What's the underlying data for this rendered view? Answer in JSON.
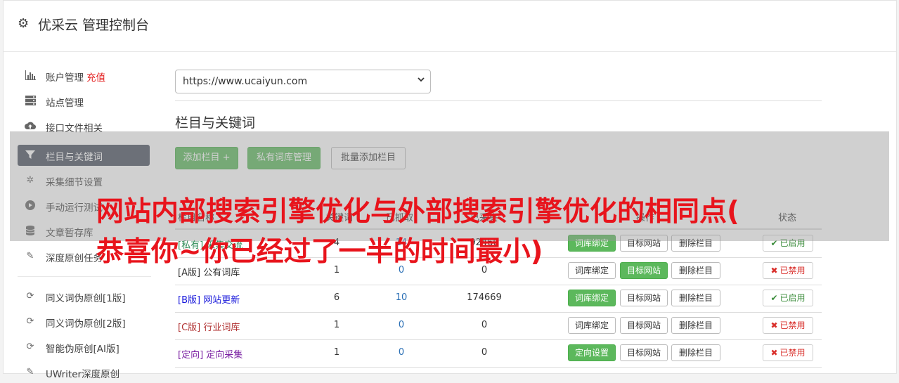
{
  "header": {
    "title": "优采云 管理控制台",
    "icon": "gear-icon"
  },
  "sidebar": {
    "items": [
      {
        "label": "账户管理",
        "badge": "充值",
        "icon": "bar-chart-icon"
      },
      {
        "label": "站点管理",
        "icon": "server-icon"
      },
      {
        "label": "接口文件相关",
        "icon": "cloud-upload-icon"
      },
      {
        "label": "栏目与关键词",
        "icon": "filter-icon"
      },
      {
        "label": "采集细节设置",
        "icon": "cogs-icon"
      },
      {
        "label": "手动运行测试",
        "icon": "play-circle-icon"
      },
      {
        "label": "文章暂存库",
        "icon": "database-icon"
      },
      {
        "label": "深度原创任务",
        "icon": "edit-icon"
      },
      {
        "label": "同义词伪原创[1版]",
        "icon": "refresh-icon"
      },
      {
        "label": "同义词伪原创[2版]",
        "icon": "refresh-icon"
      },
      {
        "label": "智能伪原创[AI版]",
        "icon": "refresh-icon"
      },
      {
        "label": "UWriter深度原创",
        "icon": "edit-icon"
      }
    ]
  },
  "main": {
    "site_select": {
      "value": "https://www.ucaiyun.com"
    },
    "section_title": "栏目与关键词",
    "buttons": {
      "add_column": "添加栏目 +",
      "private_lib": "私有词库管理",
      "batch_add": "批量添加栏目"
    },
    "table": {
      "headers": {
        "name": "栏目名称",
        "col2": "关键词",
        "col3": "已抓取",
        "col4": "已采集",
        "ops": "操作",
        "status": "状态"
      },
      "rows": [
        {
          "tag": "[私有]",
          "name": "采集交流",
          "a": "4",
          "b": "14",
          "c": "92460",
          "op1": "词库绑定",
          "op1_green": true,
          "op2": "目标网站",
          "op2_green": false,
          "op3": "删除栏目",
          "status": "已启用",
          "enabled": true
        },
        {
          "tag": "[A版]",
          "name": "公有词库",
          "a": "1",
          "b": "0",
          "c": "0",
          "op1": "词库绑定",
          "op1_green": false,
          "op2": "目标网站",
          "op2_green": true,
          "op3": "删除栏目",
          "status": "已禁用",
          "enabled": false
        },
        {
          "tag": "[B版]",
          "name": "网站更新",
          "a": "6",
          "b": "10",
          "c": "174669",
          "op1": "词库绑定",
          "op1_green": true,
          "op2": "目标网站",
          "op2_green": false,
          "op3": "删除栏目",
          "status": "已启用",
          "enabled": true
        },
        {
          "tag": "[C版]",
          "name": "行业词库",
          "a": "1",
          "b": "0",
          "c": "0",
          "op1": "词库绑定",
          "op1_green": false,
          "op2": "目标网站",
          "op2_green": false,
          "op3": "删除栏目",
          "status": "已禁用",
          "enabled": false
        },
        {
          "tag": "[定向]",
          "name": "定向采集",
          "a": "1",
          "b": "0",
          "c": "0",
          "op1": "定向设置",
          "op1_green": true,
          "op2": "目标网站",
          "op2_green": false,
          "op3": "删除栏目",
          "status": "已禁用",
          "enabled": false
        }
      ]
    }
  },
  "overlay": {
    "line1": "网站内部搜索引擎优化与外部搜索引擎优化的相同点(",
    "line2": "恭喜你~你已经过了一半的时间最小)"
  },
  "colors": {
    "accent_green": "#5cb85c",
    "sidebar_active": "#4a5160",
    "overlay_red": "#e8141c",
    "tag_private": "#2e8b57",
    "tag_a": "#333333",
    "tag_b": "#1a1adb",
    "tag_c": "#b03030",
    "tag_dir": "#7a1fa2"
  }
}
